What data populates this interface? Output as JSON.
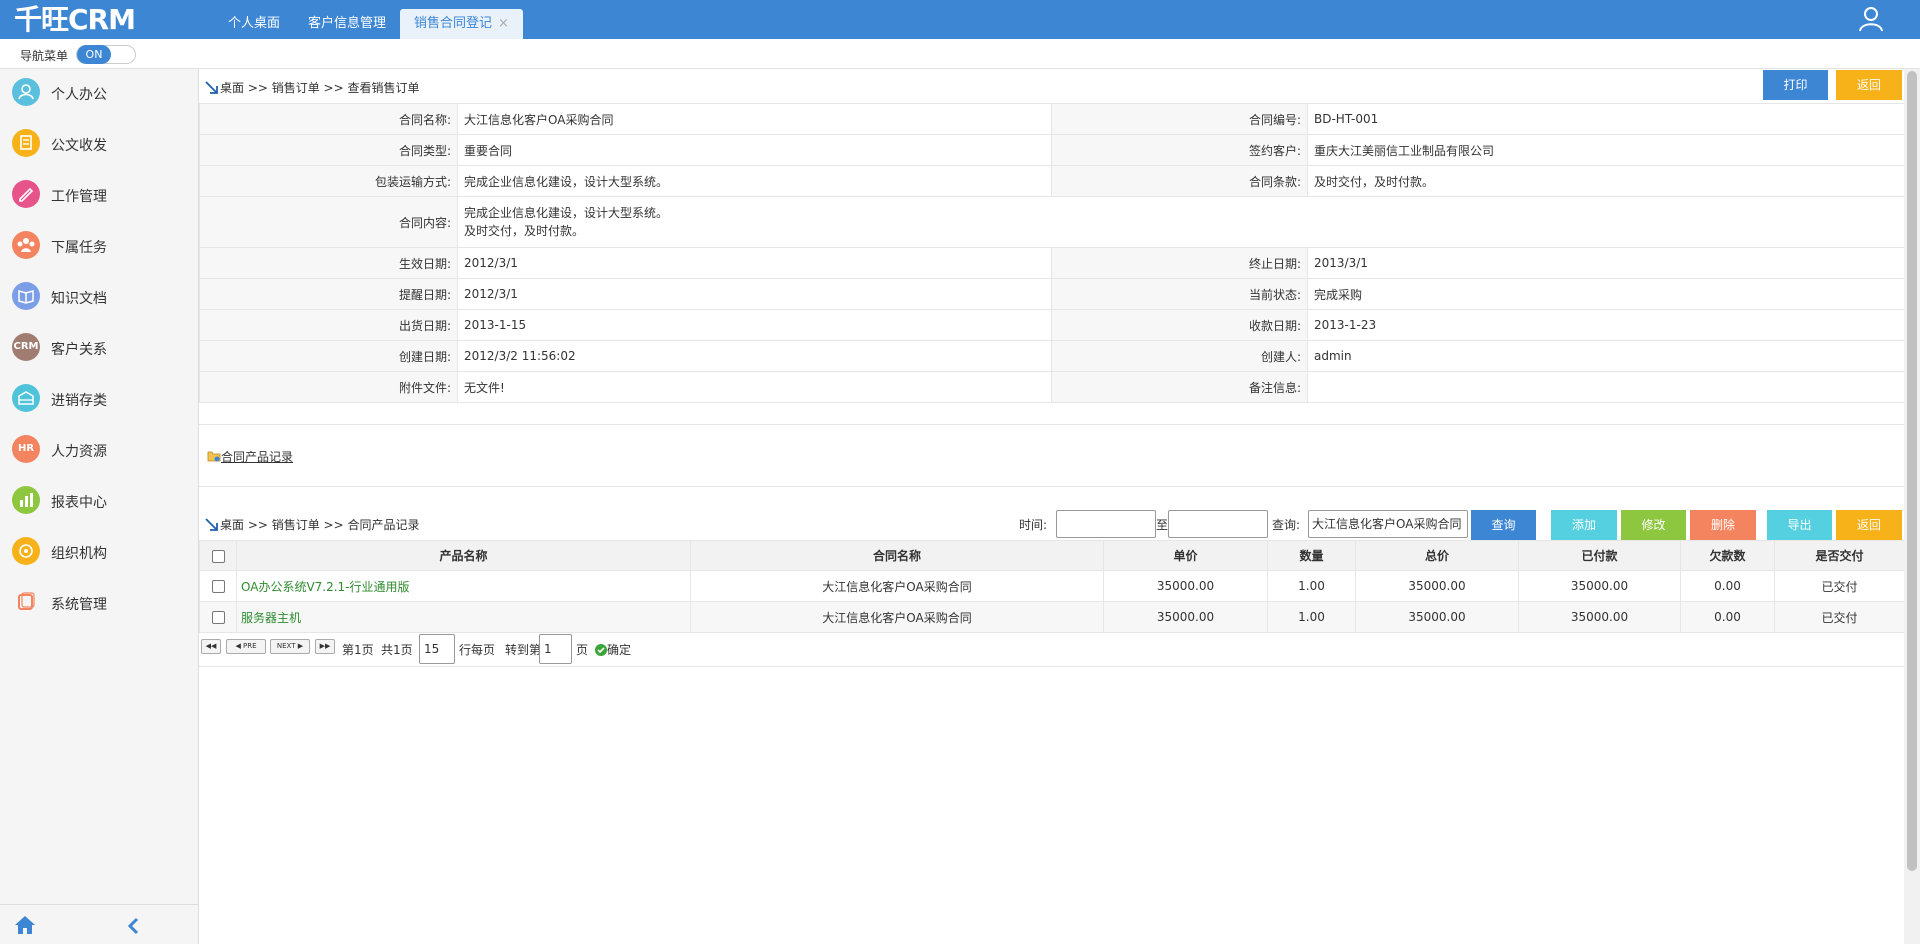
{
  "app": {
    "logo": "千旺CRM"
  },
  "tabs": [
    {
      "label": "个人桌面"
    },
    {
      "label": "客户信息管理"
    },
    {
      "label": "销售合同登记",
      "close": "×"
    }
  ],
  "nav": {
    "label": "导航菜单",
    "toggle": "ON"
  },
  "sidebar": {
    "items": [
      {
        "label": "个人办公",
        "icon": "person-icon",
        "color": "#5bc0de"
      },
      {
        "label": "公文收发",
        "icon": "document-icon",
        "color": "#f7b21a"
      },
      {
        "label": "工作管理",
        "icon": "edit-icon",
        "color": "#e6548a"
      },
      {
        "label": "下属任务",
        "icon": "team-icon",
        "color": "#f4845f"
      },
      {
        "label": "知识文档",
        "icon": "book-icon",
        "color": "#7b9ee6"
      },
      {
        "label": "客户关系",
        "icon": "crm-icon",
        "color": "#a07d70",
        "badge": "CRM"
      },
      {
        "label": "进销存类",
        "icon": "stock-icon",
        "color": "#4fc3d9"
      },
      {
        "label": "人力资源",
        "icon": "hr-icon",
        "color": "#f4845f",
        "badge": "HR"
      },
      {
        "label": "报表中心",
        "icon": "chart-icon",
        "color": "#8dc63f"
      },
      {
        "label": "组织机构",
        "icon": "org-icon",
        "color": "#f7b21a"
      },
      {
        "label": "系统管理",
        "icon": "window-icon",
        "color": "#f4845f"
      }
    ]
  },
  "breadcrumb1": "桌面 >> 销售订单 >> 查看销售订单",
  "buttons": {
    "print": "打印",
    "back": "返回"
  },
  "detail": {
    "contract_name_k": "合同名称:",
    "contract_name_v": "大江信息化客户OA采购合同",
    "contract_no_k": "合同编号:",
    "contract_no_v": "BD-HT-001",
    "contract_type_k": "合同类型:",
    "contract_type_v": "重要合同",
    "customer_k": "签约客户:",
    "customer_v": "重庆大江美丽信工业制品有限公司",
    "shipping_k": "包装运输方式:",
    "shipping_v": "完成企业信息化建设，设计大型系统。",
    "terms_k": "合同条款:",
    "terms_v": "及时交付，及时付款。",
    "content_k": "合同内容:",
    "content_v1": "完成企业信息化建设，设计大型系统。",
    "content_v2": "及时交付，及时付款。",
    "effective_k": "生效日期:",
    "effective_v": "2012/3/1",
    "end_k": "终止日期:",
    "end_v": "2013/3/1",
    "remind_k": "提醒日期:",
    "remind_v": "2012/3/1",
    "status_k": "当前状态:",
    "status_v": "完成采购",
    "ship_date_k": "出货日期:",
    "ship_date_v": "2013-1-15",
    "receive_k": "收款日期:",
    "receive_v": "2013-1-23",
    "created_k": "创建日期:",
    "created_v": "2012/3/2 11:56:02",
    "creator_k": "创建人:",
    "creator_v": "admin",
    "attach_k": "附件文件:",
    "attach_v": "无文件!",
    "remark_k": "备注信息:",
    "remark_v": ""
  },
  "section_link": "合同产品记录",
  "breadcrumb2": "桌面 >> 销售订单 >> 合同产品记录",
  "search": {
    "time_label": "时间:",
    "to_label": "至",
    "query_label": "查询:",
    "query_value": "大江信息化客户OA采购合同",
    "query_btn": "查询",
    "add": "添加",
    "edit": "修改",
    "delete": "删除",
    "export": "导出",
    "back": "返回"
  },
  "table": {
    "headers": [
      "产品名称",
      "合同名称",
      "单价",
      "数量",
      "总价",
      "已付款",
      "欠款数",
      "是否交付"
    ],
    "rows": [
      [
        "OA办公系统V7.2.1-行业通用版",
        "大江信息化客户OA采购合同",
        "35000.00",
        "1.00",
        "35000.00",
        "35000.00",
        "0.00",
        "已交付"
      ],
      [
        "服务器主机",
        "大江信息化客户OA采购合同",
        "35000.00",
        "1.00",
        "35000.00",
        "35000.00",
        "0.00",
        "已交付"
      ]
    ]
  },
  "pager": {
    "first": "◀◀",
    "prev": "◀ PRE",
    "next": "NEXT ▶",
    "last": "▶▶",
    "page_text": "第1页",
    "total_text": "共1页",
    "per_page": "15",
    "per_page_label": "行每页",
    "goto_label": "转到第",
    "goto_value": "1",
    "page_unit": "页",
    "confirm": "确定"
  }
}
